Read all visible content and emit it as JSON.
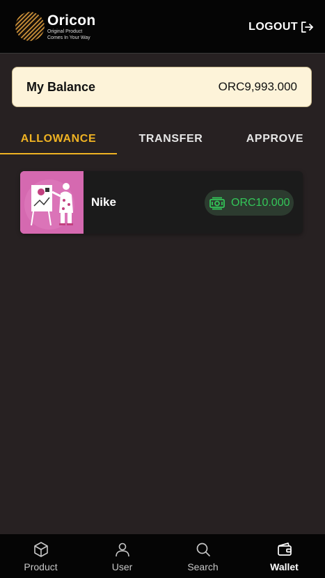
{
  "header": {
    "brand_name": "Oricon",
    "tagline_line1": "Original Product",
    "tagline_line2": "Comes In Your Way",
    "logout_label": "LOGOUT"
  },
  "balance": {
    "label": "My Balance",
    "value": "ORC9,993.000"
  },
  "tabs": [
    {
      "label": "ALLOWANCE",
      "active": true
    },
    {
      "label": "TRANSFER",
      "active": false
    },
    {
      "label": "APPROVE",
      "active": false
    }
  ],
  "allowances": [
    {
      "name": "Nike",
      "amount": "ORC10.000",
      "icon": "cash-icon"
    }
  ],
  "bottom_nav": [
    {
      "label": "Product",
      "icon": "cube-icon"
    },
    {
      "label": "User",
      "icon": "user-icon"
    },
    {
      "label": "Search",
      "icon": "search-icon"
    },
    {
      "label": "Wallet",
      "icon": "wallet-icon",
      "active": true
    }
  ],
  "colors": {
    "accent": "#f0b323",
    "background": "#272122",
    "topbar": "#050505",
    "balance_card": "#fdf3d9",
    "amount_green": "#34c759",
    "thumb_pink": "#d569b0"
  }
}
